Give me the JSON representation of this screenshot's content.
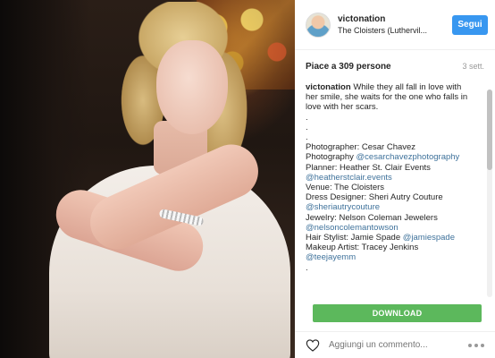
{
  "post": {
    "username": "victonation",
    "location": "The Cloisters (Luthervil...",
    "follow_label": "Segui",
    "likes": "Piace a 309 persone",
    "time": "3 sett.",
    "caption": {
      "username": "victonation",
      "text": "While they all fall in love with her smile, she waits for the one who falls in love with her scars.",
      "lines": [
        ".",
        ".",
        ".",
        "Photographer: Cesar Chavez",
        "Photography ",
        "Planner: Heather St. Clair Events",
        "",
        "Venue: The Cloisters",
        "Dress Designer: Sheri Autry Couture",
        "",
        "Jewelry: Nelson Coleman Jewelers",
        "",
        "Hair Stylist: Jamie Spade ",
        "Makeup Artist: Tracey Jenkins",
        "",
        "."
      ],
      "mentions": {
        "photography": "@cesarchavezphotography",
        "planner": "@heatherstclair.events",
        "dress": "@sheriautrycouture",
        "jewelry": "@nelsoncolemantowson",
        "hair": "@jamiespade",
        "makeup": "@teejayemm"
      }
    },
    "download_label": "DOWNLOAD",
    "comment_placeholder": "Aggiungi un commento..."
  },
  "icons": {
    "avatar": "avatar",
    "like": "heart-icon",
    "more": "more-options-icon"
  },
  "colors": {
    "follow_button": "#3897f0",
    "download_button": "#5cb85c",
    "mention": "#3f729b"
  }
}
